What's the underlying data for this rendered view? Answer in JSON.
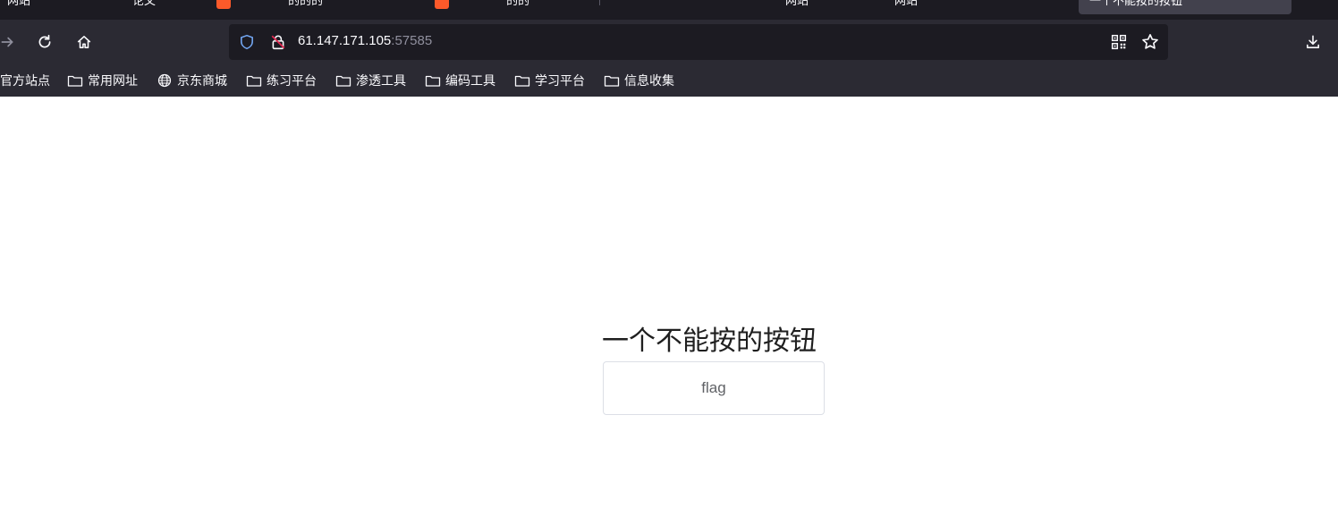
{
  "browser": {
    "tabs": [
      {
        "label": "网站"
      },
      {
        "label": "论文"
      },
      {
        "label": "的的的"
      },
      {
        "label": "的的"
      },
      {
        "label": "网站"
      },
      {
        "label": "网站"
      }
    ],
    "active_tab": {
      "label": "一个不能按的按钮"
    },
    "url": {
      "host": "61.147.171.105",
      "port": ":57585"
    },
    "colors": {
      "accent_favicon": "#fc5a2a",
      "toolbar": "#2b2a33",
      "urlbar": "#1c1b22"
    },
    "icons": [
      "forward-icon",
      "reload-icon",
      "home-icon",
      "shield-icon",
      "insecure-lock-icon",
      "qr-code-icon",
      "bookmark-star-icon",
      "download-icon"
    ]
  },
  "bookmarks": [
    {
      "label": "官方站点",
      "icon": "none"
    },
    {
      "label": "常用网址",
      "icon": "folder-icon"
    },
    {
      "label": "京东商城",
      "icon": "globe-icon"
    },
    {
      "label": "练习平台",
      "icon": "folder-icon"
    },
    {
      "label": "渗透工具",
      "icon": "folder-icon"
    },
    {
      "label": "编码工具",
      "icon": "folder-icon"
    },
    {
      "label": "学习平台",
      "icon": "folder-icon"
    },
    {
      "label": "信息收集",
      "icon": "folder-icon"
    }
  ],
  "page": {
    "title": "一个不能按的按钮",
    "button_label": "flag"
  }
}
